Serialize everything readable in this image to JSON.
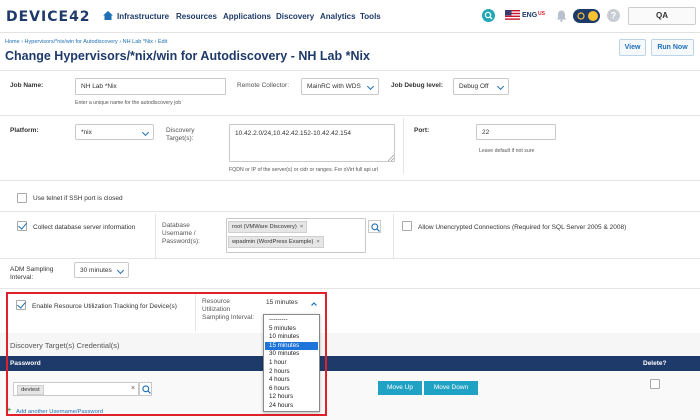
{
  "topnav": {
    "logo": "DEVICE42",
    "items": [
      "Infrastructure",
      "Resources",
      "Applications",
      "Discovery",
      "Analytics",
      "Tools"
    ],
    "lang": "ENG",
    "lang_region": "US",
    "user": "QA"
  },
  "header": {
    "breadcrumb": "Home › Hypervisors/*nix/win for Autodiscovery › NH Lab *Nix › Edit",
    "title": "Change Hypervisors/*nix/win for Autodiscovery - NH Lab *Nix",
    "view_label": "View",
    "run_now_label": "Run Now"
  },
  "form": {
    "job_name_label": "Job Name:",
    "job_name_value": "NH Lab *Nix",
    "job_name_hint": "Enter a unique name for the autodiscovery job",
    "remote_collector_label": "Remote Collector:",
    "remote_collector_value": "MainRC with WDS",
    "job_debug_label": "Job Debug level:",
    "job_debug_value": "Debug Off",
    "platform_label": "Platform:",
    "platform_value": "*nix",
    "discovery_targets_label_1": "Discovery",
    "discovery_targets_label_2": "Target(s):",
    "discovery_targets_value": "10.42.2.0/24,10.42.42.152-10.42.42.154",
    "discovery_targets_hint": "FQDN or IP of the server(s) or cidr or ranges. For oVirt full api url",
    "port_label": "Port:",
    "port_value": "22",
    "port_hint": "Leave default if not sure",
    "telnet_label": "Use telnet if SSH port is closed",
    "collect_db_label": "Collect database server information",
    "db_cred_label_1": "Database",
    "db_cred_label_2": "Username /",
    "db_cred_label_3": "Password(s):",
    "db_cred_tags": [
      "root (VMWare Discovery)",
      "wpadmin (WordPress Example)"
    ],
    "unencrypted_label": "Allow Unencrypted Connections (Required for SQL Server 2005 & 2008)",
    "adm_label_1": "ADM Sampling",
    "adm_label_2": "Interval:",
    "adm_value": "30 minutes",
    "resource_tracking_label": "Enable Resource Utilization Tracking for Device(s)",
    "resource_interval_label_1": "Resource",
    "resource_interval_label_2": "Utilization",
    "resource_interval_label_3": "Sampling Interval:",
    "resource_interval_value": "15 minutes",
    "resource_interval_options": [
      "---------",
      "5 minutes",
      "10 minutes",
      "15 minutes",
      "30 minutes",
      "1 hour",
      "2 hours",
      "4 hours",
      "6 hours",
      "12 hours",
      "24 hours"
    ],
    "resource_interval_selected_index": 3
  },
  "credentials": {
    "section_title": "Discovery Target(s) Credential(s)",
    "col_password": "Password",
    "col_delete": "Delete?",
    "row_value": "devtest",
    "move_up": "Move Up",
    "move_down": "Move Down",
    "add_link": "Add another Username/Password"
  },
  "colors": {
    "navy": "#1e3a6a",
    "accent_blue": "#1e6fb4",
    "highlight_red": "#e0202a",
    "button_teal": "#20a2c4"
  }
}
